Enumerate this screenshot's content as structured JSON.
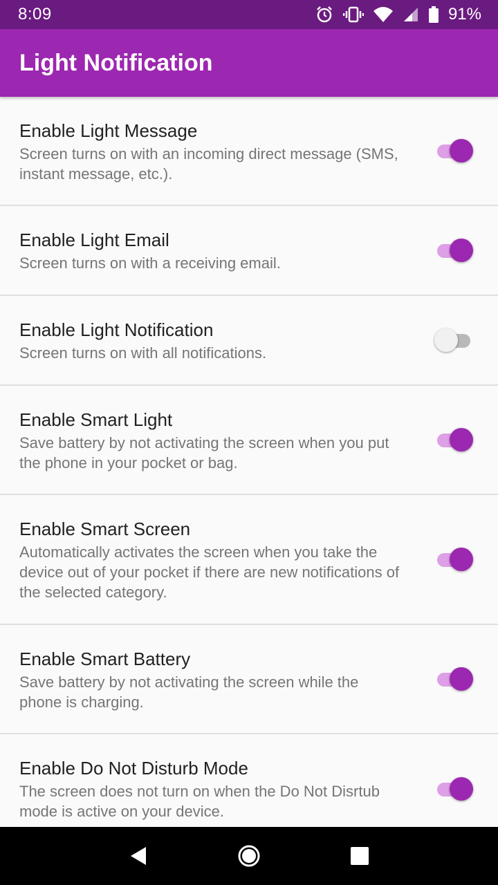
{
  "status_bar": {
    "time": "8:09",
    "battery": "91%",
    "icons": [
      "alarm-icon",
      "vibrate-icon",
      "wifi-icon",
      "signal-icon",
      "battery-icon"
    ]
  },
  "app_bar": {
    "title": "Light Notification"
  },
  "colors": {
    "status_bar": "#6a1b7f",
    "primary": "#9c27b0",
    "switch_track_on": "#dd9fe6",
    "switch_track_off": "#b9b9b9",
    "background": "#fafafa"
  },
  "settings": [
    {
      "title": "Enable Light Message",
      "summary": "Screen turns on with an incoming direct message (SMS, instant message, etc.).",
      "enabled": true
    },
    {
      "title": "Enable Light Email",
      "summary": "Screen turns on with a receiving email.",
      "enabled": true
    },
    {
      "title": "Enable Light Notification",
      "summary": "Screen turns on with all notifications.",
      "enabled": false
    },
    {
      "title": "Enable Smart Light",
      "summary": "Save battery by not activating the screen when you put the phone in your pocket or bag.",
      "enabled": true
    },
    {
      "title": "Enable Smart Screen",
      "summary": "Automatically activates the screen when you take the device out of your pocket if there are new notifications of the selected category.",
      "enabled": true
    },
    {
      "title": "Enable Smart Battery",
      "summary": "Save battery by not activating the screen while the phone is charging.",
      "enabled": true
    },
    {
      "title": "Enable Do Not Disturb Mode",
      "summary": "The screen does not turn on when the Do Not Disrtub mode is active on your device.",
      "enabled": true
    }
  ],
  "nav_bar": {
    "icons": [
      "back-icon",
      "home-icon",
      "recents-icon"
    ]
  }
}
